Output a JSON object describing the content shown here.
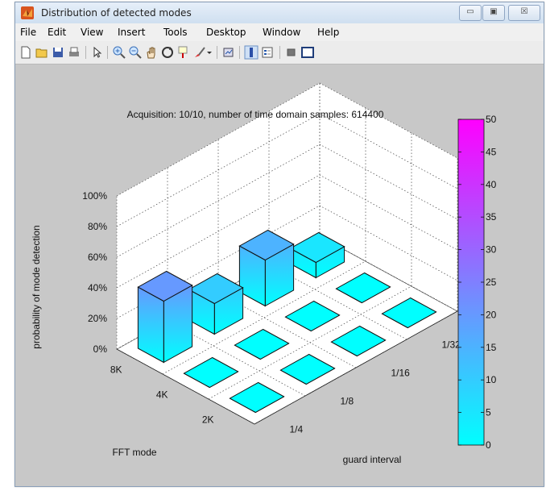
{
  "window": {
    "title": "Distribution of detected modes",
    "icon": "matlab-icon",
    "controls": {
      "minimize": "▭",
      "maximize": "▣",
      "close": "☒"
    }
  },
  "menu": [
    "File",
    "Edit",
    "View",
    "Insert",
    "Tools",
    "Desktop",
    "Window",
    "Help"
  ],
  "toolbar": [
    "new-figure-icon",
    "open-file-icon",
    "save-icon",
    "print-icon",
    "select-arrow-icon",
    "zoom-in-icon",
    "zoom-out-icon",
    "pan-hand-icon",
    "rotate-3d-icon",
    "data-cursor-icon",
    "brush-icon",
    "brush-dropdown-icon",
    "link-plot-icon",
    "colorbar-icon",
    "legend-icon",
    "hide-plot-tools-icon",
    "show-plot-tools-icon"
  ],
  "chart_data": {
    "type": "bar3",
    "title": "Acquisition: 10/10, number of time domain samples: 614400",
    "zlabel": "probability of mode detection",
    "xlabel": "FFT mode",
    "ylabel": "guard interval",
    "fft_modes": [
      "2K",
      "4K",
      "8K"
    ],
    "guard_intervals": [
      "1/4",
      "1/8",
      "1/16",
      "1/32"
    ],
    "z_ticks": [
      "0%",
      "20%",
      "40%",
      "60%",
      "80%",
      "100%"
    ],
    "zlim": [
      0,
      1
    ],
    "values": [
      {
        "fft": "8K",
        "gi": "1/4",
        "value": 0.4
      },
      {
        "fft": "8K",
        "gi": "1/8",
        "value": 0.2
      },
      {
        "fft": "8K",
        "gi": "1/16",
        "value": 0.3
      },
      {
        "fft": "8K",
        "gi": "1/32",
        "value": 0.1
      },
      {
        "fft": "4K",
        "gi": "1/4",
        "value": 0.0
      },
      {
        "fft": "4K",
        "gi": "1/8",
        "value": 0.0
      },
      {
        "fft": "4K",
        "gi": "1/16",
        "value": 0.0
      },
      {
        "fft": "4K",
        "gi": "1/32",
        "value": 0.0
      },
      {
        "fft": "2K",
        "gi": "1/4",
        "value": 0.0
      },
      {
        "fft": "2K",
        "gi": "1/8",
        "value": 0.0
      },
      {
        "fft": "2K",
        "gi": "1/16",
        "value": 0.0
      },
      {
        "fft": "2K",
        "gi": "1/32",
        "value": 0.0
      }
    ],
    "colorbar": {
      "ticks": [
        "0",
        "5",
        "10",
        "15",
        "20",
        "25",
        "30",
        "35",
        "40",
        "45",
        "50"
      ],
      "min": 0,
      "max": 50,
      "color_low": "#00ffff",
      "color_high": "#ff00ff"
    },
    "grid": true
  }
}
